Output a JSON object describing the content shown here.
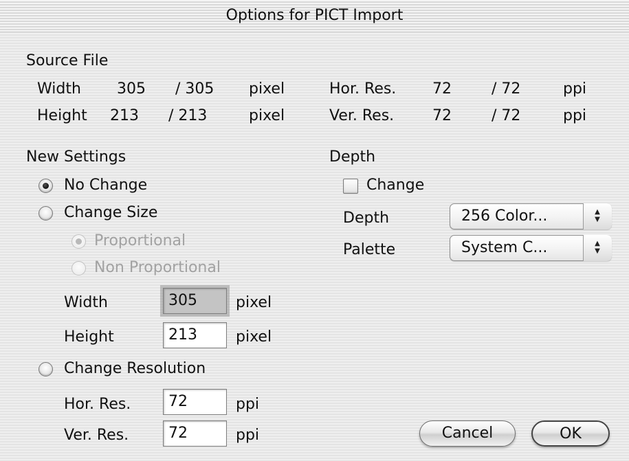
{
  "window": {
    "title": "Options for PICT Import"
  },
  "source": {
    "heading": "Source File",
    "width_label": "Width",
    "width_value": "305",
    "width_orig": "/ 305",
    "width_unit": "pixel",
    "height_label": "Height",
    "height_value": "213",
    "height_orig": "/ 213",
    "height_unit": "pixel",
    "hres_label": "Hor. Res.",
    "hres_value": "72",
    "hres_orig": "/ 72",
    "hres_unit": "ppi",
    "vres_label": "Ver. Res.",
    "vres_value": "72",
    "vres_orig": "/ 72",
    "vres_unit": "ppi"
  },
  "settings": {
    "heading": "New Settings",
    "no_change_label": "No Change",
    "change_size_label": "Change Size",
    "proportional_label": "Proportional",
    "non_proportional_label": "Non Proportional",
    "width_label": "Width",
    "width_value": "305",
    "width_unit": "pixel",
    "height_label": "Height",
    "height_value": "213",
    "height_unit": "pixel",
    "change_resolution_label": "Change Resolution",
    "hres_label": "Hor. Res.",
    "hres_value": "72",
    "hres_unit": "ppi",
    "vres_label": "Ver. Res.",
    "vres_value": "72",
    "vres_unit": "ppi",
    "selected": "No Change",
    "size_mode_selected": "Proportional"
  },
  "depth": {
    "heading": "Depth",
    "change_label": "Change",
    "change_checked": false,
    "depth_label": "Depth",
    "depth_value": "256 Color...",
    "palette_label": "Palette",
    "palette_value": "System C..."
  },
  "buttons": {
    "cancel": "Cancel",
    "ok": "OK"
  }
}
